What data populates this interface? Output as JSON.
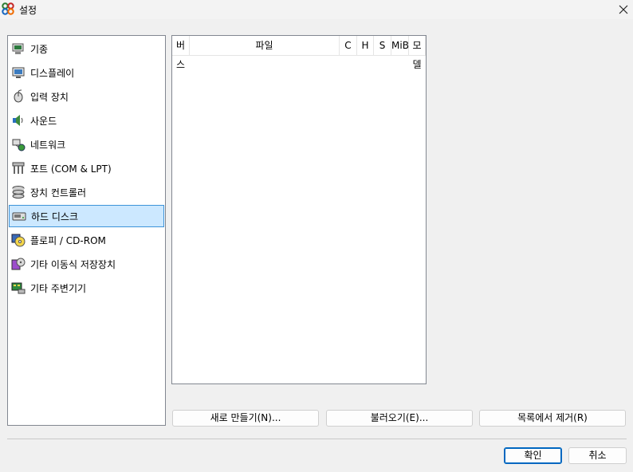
{
  "window": {
    "title": "설정",
    "close_label": "✕"
  },
  "categories": [
    {
      "label": "기종",
      "icon": "machine-icon"
    },
    {
      "label": "디스플레이",
      "icon": "display-icon"
    },
    {
      "label": "입력 장치",
      "icon": "input-device-icon"
    },
    {
      "label": "사운드",
      "icon": "sound-icon"
    },
    {
      "label": "네트워크",
      "icon": "network-icon"
    },
    {
      "label": "포트 (COM & LPT)",
      "icon": "port-icon"
    },
    {
      "label": "장치 컨트롤러",
      "icon": "storage-controller-icon"
    },
    {
      "label": "하드 디스크",
      "icon": "hard-disk-icon",
      "selected": true
    },
    {
      "label": "플로피 / CD-ROM",
      "icon": "floppy-cdrom-icon"
    },
    {
      "label": "기타 이동식 저장장치",
      "icon": "removable-storage-icon"
    },
    {
      "label": "기타 주변기기",
      "icon": "peripherals-icon"
    }
  ],
  "table": {
    "columns": [
      "버스",
      "파일",
      "C",
      "H",
      "S",
      "MiB",
      "모델"
    ],
    "rows": []
  },
  "buttons": {
    "new": "새로 만들기(N)...",
    "existing": "불러오기(E)...",
    "remove": "목록에서 제거(R)",
    "ok": "확인",
    "cancel": "취소"
  }
}
